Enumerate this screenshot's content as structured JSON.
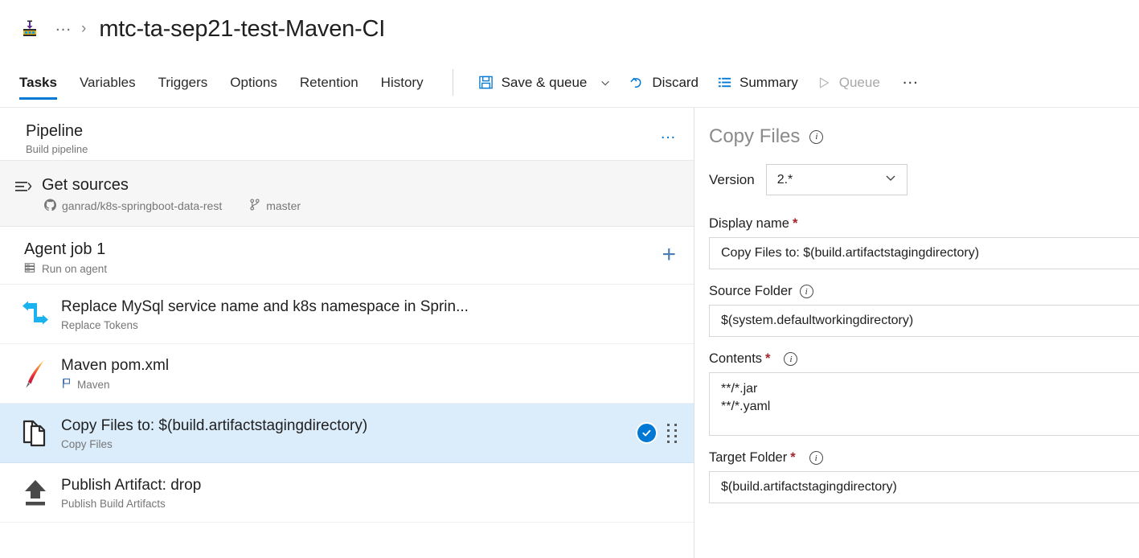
{
  "header": {
    "hub_icon": "build-pipeline-icon",
    "overflow_label": "…",
    "chevron": "›",
    "title": "mtc-ta-sep21-test-Maven-CI"
  },
  "toolbar": {
    "tabs": [
      {
        "label": "Tasks",
        "active": true
      },
      {
        "label": "Variables",
        "active": false
      },
      {
        "label": "Triggers",
        "active": false
      },
      {
        "label": "Options",
        "active": false
      },
      {
        "label": "Retention",
        "active": false
      },
      {
        "label": "History",
        "active": false
      }
    ],
    "commands": [
      {
        "label": "Save & queue",
        "icon": "save-icon",
        "has_caret": true,
        "disabled": false
      },
      {
        "label": "Discard",
        "icon": "undo-icon",
        "has_caret": false,
        "disabled": false
      },
      {
        "label": "Summary",
        "icon": "list-icon",
        "has_caret": false,
        "disabled": false
      },
      {
        "label": "Queue",
        "icon": "play-icon",
        "has_caret": false,
        "disabled": true
      }
    ],
    "overflow_label": "…"
  },
  "pipeline": {
    "header": {
      "title": "Pipeline",
      "subtitle": "Build pipeline",
      "overflow_label": "…"
    },
    "get_sources": {
      "title": "Get sources",
      "repo": "ganrad/k8s-springboot-data-rest",
      "branch": "master",
      "repo_icon": "github-icon",
      "branch_icon": "branch-icon",
      "section_icon": "get-sources-icon"
    },
    "agent_job": {
      "title": "Agent job 1",
      "subtitle": "Run on agent",
      "subtitle_icon": "server-icon",
      "add_label": "+"
    },
    "tasks": [
      {
        "title": "Replace MySql service name and k8s namespace in Sprin...",
        "subtitle": "Replace Tokens",
        "icon": "replace-tokens-icon",
        "selected": false,
        "subtitle_icon": null,
        "has_check": false
      },
      {
        "title": "Maven pom.xml",
        "subtitle": "Maven",
        "icon": "apache-feather-icon",
        "selected": false,
        "subtitle_icon": "flag-icon",
        "has_check": false
      },
      {
        "title": "Copy Files to: $(build.artifactstagingdirectory)",
        "subtitle": "Copy Files",
        "icon": "copy-files-icon",
        "selected": true,
        "subtitle_icon": null,
        "has_check": true
      },
      {
        "title": "Publish Artifact: drop",
        "subtitle": "Publish Build Artifacts",
        "icon": "publish-artifact-icon",
        "selected": false,
        "subtitle_icon": null,
        "has_check": false
      }
    ]
  },
  "details": {
    "title": "Copy Files",
    "version": {
      "label": "Version",
      "value": "2.*"
    },
    "fields": [
      {
        "label": "Display name",
        "required": true,
        "has_info": false,
        "value": "Copy Files to: $(build.artifactstagingdirectory)",
        "type": "input"
      },
      {
        "label": "Source Folder",
        "required": false,
        "has_info": true,
        "value": "$(system.defaultworkingdirectory)",
        "type": "input"
      },
      {
        "label": "Contents",
        "required": true,
        "has_info": true,
        "value": "**/*.jar\n**/*.yaml",
        "type": "textarea"
      },
      {
        "label": "Target Folder",
        "required": true,
        "has_info": true,
        "value": "$(build.artifactstagingdirectory)",
        "type": "input"
      }
    ]
  },
  "colors": {
    "accent": "#0078d4",
    "selected_row": "#dbecfb",
    "required_star": "#a4262c",
    "muted_text": "#767676"
  }
}
